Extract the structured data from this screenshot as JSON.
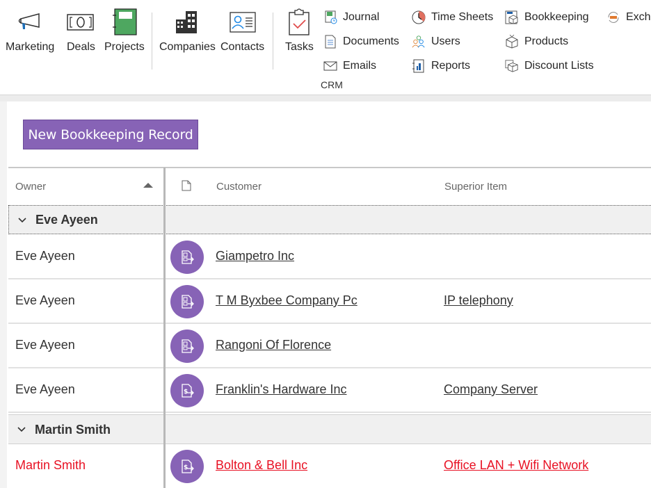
{
  "ribbon": {
    "large_buttons": [
      {
        "label": "Marketing",
        "icon": "megaphone-icon"
      },
      {
        "label": "Deals",
        "icon": "deal-bracket-icon"
      },
      {
        "label": "Projects",
        "icon": "project-notebook-icon"
      },
      {
        "label": "Companies",
        "icon": "buildings-icon"
      },
      {
        "label": "Contacts",
        "icon": "contact-card-icon"
      },
      {
        "label": "Tasks",
        "icon": "clipboard-check-icon"
      }
    ],
    "small_buttons": [
      {
        "label": "Journal",
        "icon": "journal-icon"
      },
      {
        "label": "Documents",
        "icon": "document-icon"
      },
      {
        "label": "Emails",
        "icon": "envelope-icon"
      },
      {
        "label": "Time Sheets",
        "icon": "clock-icon"
      },
      {
        "label": "Users",
        "icon": "users-icon"
      },
      {
        "label": "Reports",
        "icon": "report-chart-icon"
      },
      {
        "label": "Bookkeeping",
        "icon": "bookkeeping-box-icon"
      },
      {
        "label": "Products",
        "icon": "box-icon"
      },
      {
        "label": "Discount Lists",
        "icon": "discount-boxes-icon"
      },
      {
        "label": "Excha",
        "icon": "exchange-icon"
      }
    ],
    "group_label": "CRM"
  },
  "toolbar": {
    "new_record_label": "New Bookkeeping Record"
  },
  "grid": {
    "columns": {
      "owner": "Owner",
      "customer": "Customer",
      "superior_item": "Superior Item"
    },
    "sort": {
      "column": "Owner",
      "direction": "ascending"
    },
    "groups": [
      {
        "title": "Eve Ayeen",
        "rows": [
          {
            "owner": "Eve Ayeen",
            "customer": "Giampetro Inc",
            "superior_item": "",
            "icon": "document-transfer-icon",
            "highlight": false
          },
          {
            "owner": "Eve Ayeen",
            "customer": "T M Byxbee Company Pc",
            "superior_item": "IP telephony",
            "icon": "document-transfer-icon",
            "highlight": false
          },
          {
            "owner": "Eve Ayeen",
            "customer": "Rangoni Of Florence",
            "superior_item": "",
            "icon": "document-transfer-icon",
            "highlight": false
          },
          {
            "owner": "Eve Ayeen",
            "customer": "Franklin's Hardware Inc",
            "superior_item": "Company Server",
            "icon": "invoice-dollar-icon",
            "highlight": false
          }
        ]
      },
      {
        "title": "Martin Smith",
        "rows": [
          {
            "owner": "Martin Smith",
            "customer": "Bolton & Bell Inc",
            "superior_item": "Office LAN + Wifi Network",
            "icon": "invoice-dollar-icon",
            "highlight": true
          }
        ]
      }
    ]
  },
  "colors": {
    "accent_purple": "#8763b6",
    "overdue_red": "#e81123",
    "group_bg": "#f0f0f0"
  }
}
